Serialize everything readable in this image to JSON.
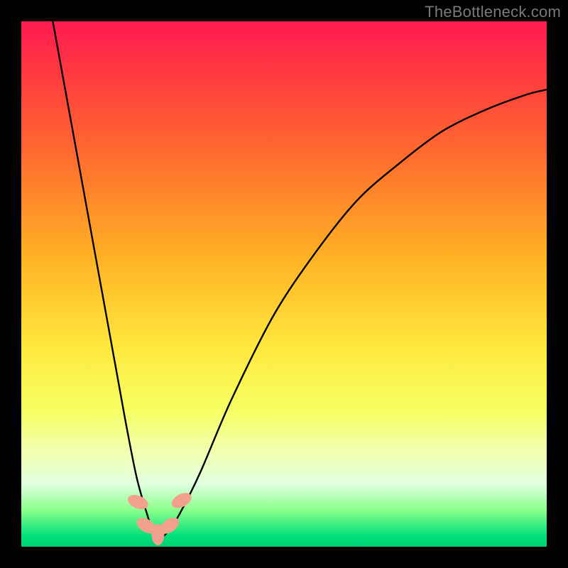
{
  "watermark": "TheBottleneck.com",
  "chart_data": {
    "type": "line",
    "title": "",
    "xlabel": "",
    "ylabel": "",
    "x_range": [
      0,
      100
    ],
    "y_range": [
      0,
      100
    ],
    "series": [
      {
        "name": "bottleneck-curve",
        "x": [
          6,
          10,
          14,
          18,
          20,
          22,
          24,
          25,
          26,
          27,
          28,
          30,
          34,
          40,
          48,
          56,
          64,
          72,
          80,
          88,
          96,
          100
        ],
        "y": [
          100,
          78,
          56,
          34,
          23,
          13,
          6,
          3,
          2,
          2,
          3,
          6,
          14,
          28,
          44,
          56,
          66,
          73,
          79,
          83,
          86,
          87
        ]
      }
    ],
    "markers": [
      {
        "name": "band-marker-1",
        "x": 22.2,
        "y": 8.5,
        "rot": -68
      },
      {
        "name": "band-marker-2",
        "x": 23.8,
        "y": 4.0,
        "rot": -58
      },
      {
        "name": "band-marker-3",
        "x": 26.0,
        "y": 2.3,
        "rot": 0
      },
      {
        "name": "band-marker-4",
        "x": 28.2,
        "y": 4.0,
        "rot": 55
      },
      {
        "name": "band-marker-5",
        "x": 30.5,
        "y": 8.8,
        "rot": 62
      }
    ],
    "marker_style": {
      "fill": "#f2a18e",
      "rx": 9,
      "ry": 15
    },
    "gradient_bands_y": [
      {
        "y": 0,
        "color": "#ff1a52"
      },
      {
        "y": 10,
        "color": "#ff3a3f"
      },
      {
        "y": 25,
        "color": "#ff6a2f"
      },
      {
        "y": 45,
        "color": "#ffb224"
      },
      {
        "y": 62,
        "color": "#ffe83e"
      },
      {
        "y": 74,
        "color": "#f6ff62"
      },
      {
        "y": 82,
        "color": "#f2ffb0"
      },
      {
        "y": 88,
        "color": "#e0ffe0"
      },
      {
        "y": 93,
        "color": "#8bff8b"
      },
      {
        "y": 98,
        "color": "#00e07a"
      },
      {
        "y": 100,
        "color": "#00d074"
      }
    ]
  }
}
